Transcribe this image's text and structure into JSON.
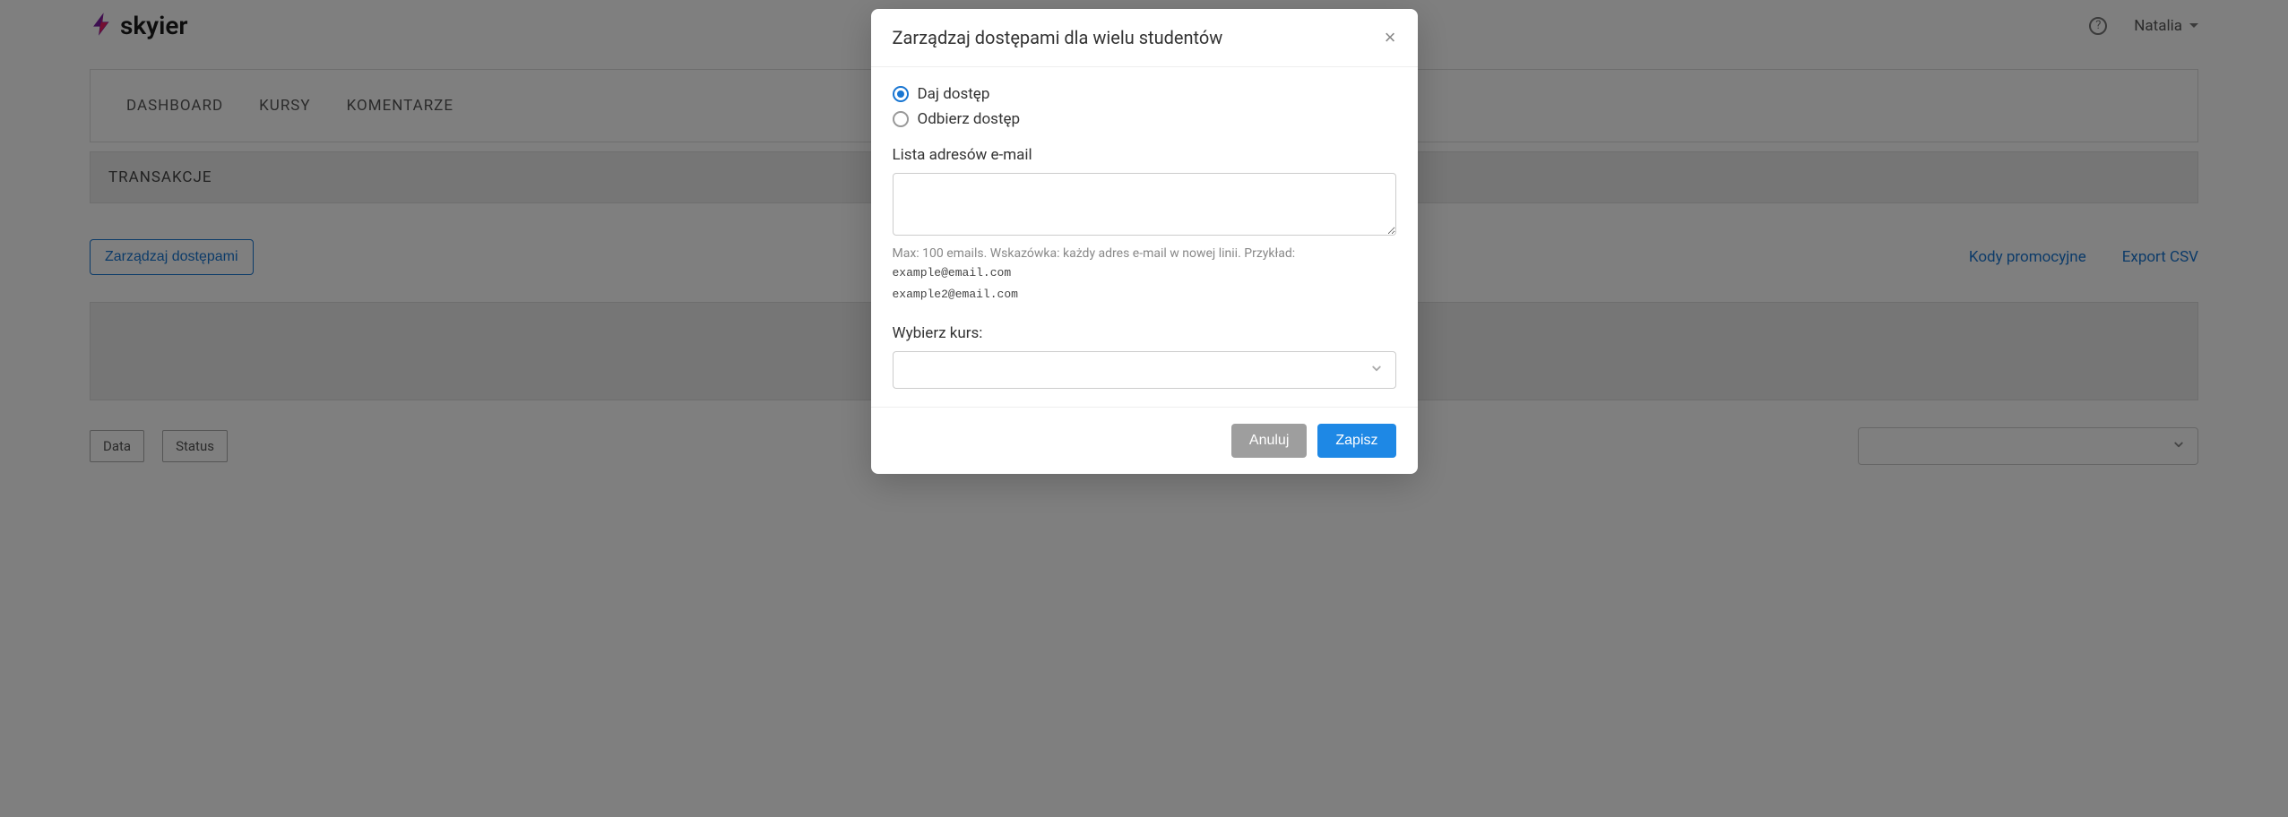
{
  "header": {
    "logo_text": "skyier",
    "user_name": "Natalia"
  },
  "nav": {
    "items": [
      "DASHBOARD",
      "KURSY",
      "KOMENTARZE"
    ]
  },
  "sub_header": "TRANSAKCJE",
  "actions": {
    "manage_access": "Zarządzaj dostępami",
    "promo_codes": "Kody promocyjne",
    "export_csv": "Export CSV"
  },
  "filters": {
    "date": "Data",
    "status": "Status"
  },
  "modal": {
    "title": "Zarządzaj dostępami dla wielu studentów",
    "radio_give": "Daj dostęp",
    "radio_revoke": "Odbierz dostęp",
    "email_list_label": "Lista adresów e-mail",
    "hint": "Max: 100 emails. Wskazówka: każdy adres e-mail w nowej linii. Przykład:",
    "example1": "example@email.com",
    "example2": "example2@email.com",
    "course_label": "Wybierz kurs:",
    "cancel": "Anuluj",
    "save": "Zapisz"
  }
}
